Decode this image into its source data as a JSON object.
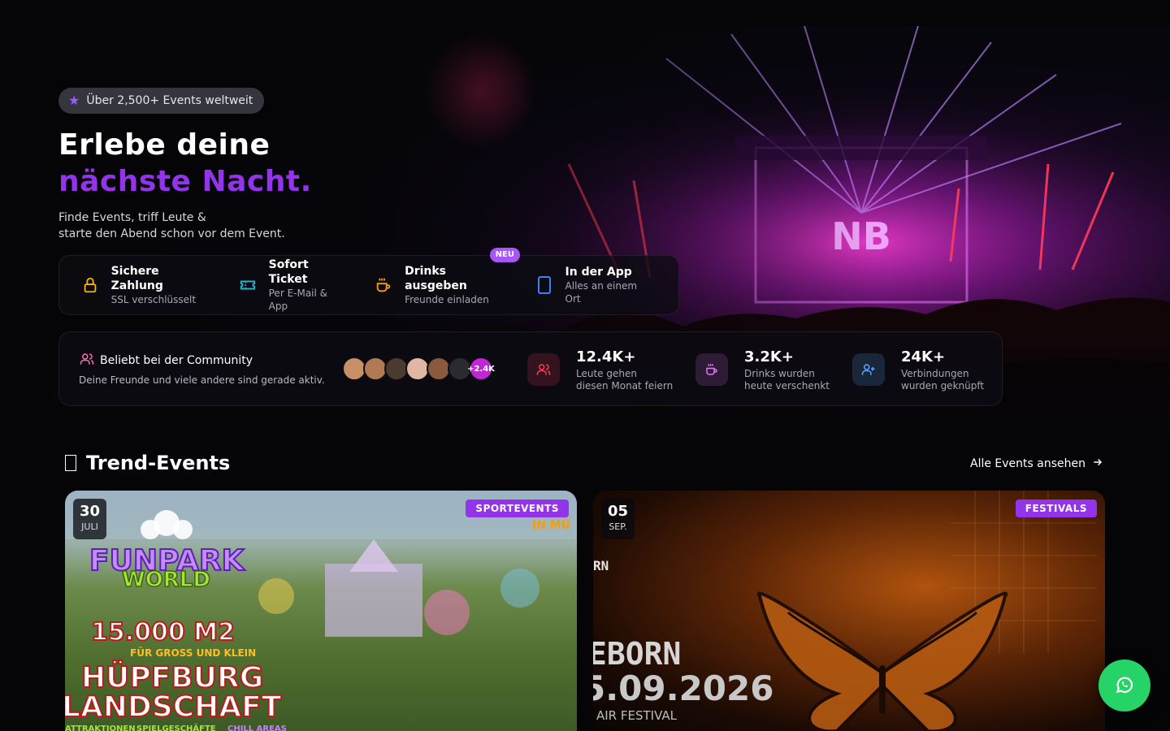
{
  "hero": {
    "pill_label": "Über 2,500+ Events weltweit",
    "headline_line1": "Erlebe deine",
    "headline_line2": "nächste Nacht.",
    "subtitle_line1": "Finde Events, triff Leute &",
    "subtitle_line2": "starte den Abend schon vor dem Event.",
    "features": [
      {
        "title": "Sichere Zahlung",
        "subtitle": "SSL verschlüsselt",
        "icon": "lock-icon",
        "color": "#f5b400"
      },
      {
        "title": "Sofort Ticket",
        "subtitle": "Per E-Mail & App",
        "icon": "ticket-icon",
        "color": "#22b8cf"
      },
      {
        "title": "Drinks ausgeben",
        "subtitle": "Freunde einladen",
        "icon": "coffee-cup-icon",
        "color": "#f59e0b",
        "badge": "NEU"
      },
      {
        "title": "In der App",
        "subtitle": "Alles an einem Ort",
        "icon": "phone-icon",
        "color": "#3b82f6"
      }
    ],
    "art_logo": "NB"
  },
  "community": {
    "title": "Beliebt bei der Community",
    "subtitle": "Deine Freunde und viele andere sind gerade aktiv.",
    "avatar_more": "+2.4K",
    "stats": [
      {
        "value": "12.4K+",
        "label_line1": "Leute gehen",
        "label_line2": "diesen Monat feiern",
        "icon": "users-icon",
        "color": "#f43f5e"
      },
      {
        "value": "3.2K+",
        "label_line1": "Drinks wurden",
        "label_line2": "heute verschenkt",
        "icon": "coffee-cup-icon",
        "color": "#e879f9"
      },
      {
        "value": "24K+",
        "label_line1": "Verbindungen",
        "label_line2": "wurden geknüpft",
        "icon": "user-plus-icon",
        "color": "#60a5fa"
      }
    ]
  },
  "trends": {
    "title": "Trend-Events",
    "all_link": "Alle Events ansehen",
    "cards": [
      {
        "day": "30",
        "month": "JULI",
        "category": "SPORTEVENTS",
        "art_lines": [
          "FUNPARK",
          "WORLD",
          "15.000 M2",
          "FÜR GROSS UND KLEIN",
          "HÜPFBURG",
          "LANDSCHAFT",
          "ATTRAKTIONEN",
          "SPIELGESCHÄFTE",
          "CHILL AREAS",
          "IN MÜ"
        ]
      },
      {
        "day": "05",
        "month": "SEP.",
        "category": "FESTIVALS",
        "art_lines": [
          "EBORN",
          "5.09.2026",
          "AIR FESTIVAL",
          "RN"
        ]
      }
    ]
  },
  "colors": {
    "accent": "#9333ea",
    "whatsapp": "#25d366"
  }
}
